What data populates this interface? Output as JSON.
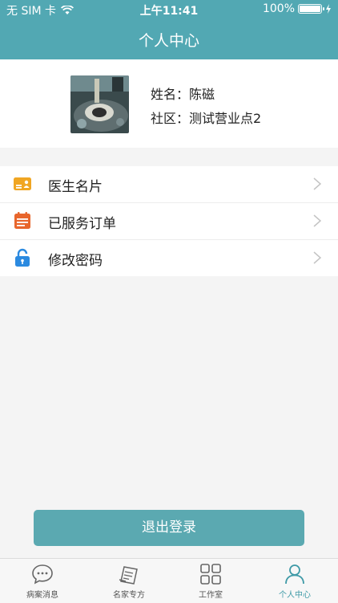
{
  "status_bar": {
    "carrier": "无 SIM 卡",
    "time": "上午11:41",
    "battery": "100%"
  },
  "nav": {
    "title": "个人中心"
  },
  "profile": {
    "name_label": "姓名：",
    "name_value": "陈磁",
    "community_label": "社区：",
    "community_value": "测试营业点2"
  },
  "menu": [
    {
      "label": "医生名片",
      "icon": "business-card-icon",
      "color": "#f0a623"
    },
    {
      "label": "已服务订单",
      "icon": "calendar-icon",
      "color": "#e8662c"
    },
    {
      "label": "修改密码",
      "icon": "lock-icon",
      "color": "#2b8ae0"
    }
  ],
  "logout": {
    "label": "退出登录"
  },
  "tabbar": [
    {
      "label": "病案消息",
      "icon": "chat-bubble-icon",
      "active": false
    },
    {
      "label": "名家专方",
      "icon": "prescription-icon",
      "active": false
    },
    {
      "label": "工作室",
      "icon": "grid-icon",
      "active": false
    },
    {
      "label": "个人中心",
      "icon": "person-icon",
      "active": true
    }
  ],
  "colors": {
    "primary": "#52a8b3",
    "button": "#5ba9b1",
    "active_tab": "#3f9aa7"
  }
}
